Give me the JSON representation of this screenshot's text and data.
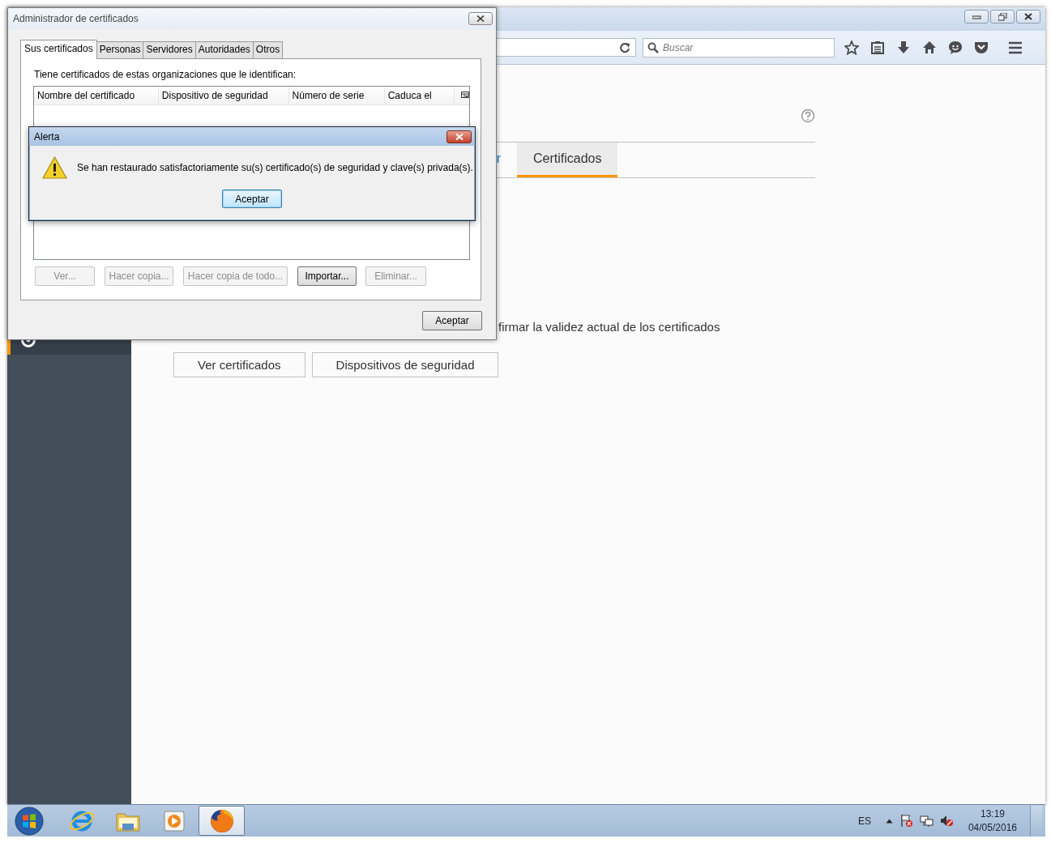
{
  "browser": {
    "search": {
      "placeholder": "Buscar"
    },
    "sidebar": {
      "items": [
        {
          "selected": true
        }
      ]
    },
    "tabs": [
      {
        "label": "r",
        "selected": false
      },
      {
        "label": "Certificados",
        "selected": true
      }
    ],
    "description": "firmar la validez actual de los certificados",
    "buttons": [
      "Ver certificados",
      "Dispositivos de seguridad"
    ]
  },
  "cert_manager": {
    "title": "Administrador de certificados",
    "tabs": [
      {
        "label": "Sus certificados",
        "selected": true
      },
      {
        "label": "Personas",
        "selected": false
      },
      {
        "label": "Servidores",
        "selected": false
      },
      {
        "label": "Autoridades",
        "selected": false
      },
      {
        "label": "Otros",
        "selected": false
      }
    ],
    "intro": "Tiene certificados de estas organizaciones que le identifican:",
    "columns": [
      "Nombre del certificado",
      "Dispositivo de seguridad",
      "Número de serie",
      "Caduca el"
    ],
    "buttons": [
      {
        "label": "Ver...",
        "disabled": true
      },
      {
        "label": "Hacer copia...",
        "disabled": true
      },
      {
        "label": "Hacer copia de todo...",
        "disabled": true
      },
      {
        "label": "Importar...",
        "disabled": false
      },
      {
        "label": "Eliminar...",
        "disabled": true
      }
    ],
    "ok": "Aceptar"
  },
  "alert": {
    "title": "Alerta",
    "message": "Se han restaurado satisfactoriamente su(s) certificado(s) de seguridad y clave(s) privada(s).",
    "button": "Aceptar"
  },
  "taskbar": {
    "apps": [
      {
        "kind": "browser",
        "selected": false
      },
      {
        "kind": "folder",
        "selected": false
      },
      {
        "kind": "media",
        "selected": false
      },
      {
        "kind": "firefox",
        "selected": true
      }
    ],
    "language": "ES",
    "time": "13:19",
    "date": "04/05/2016"
  }
}
